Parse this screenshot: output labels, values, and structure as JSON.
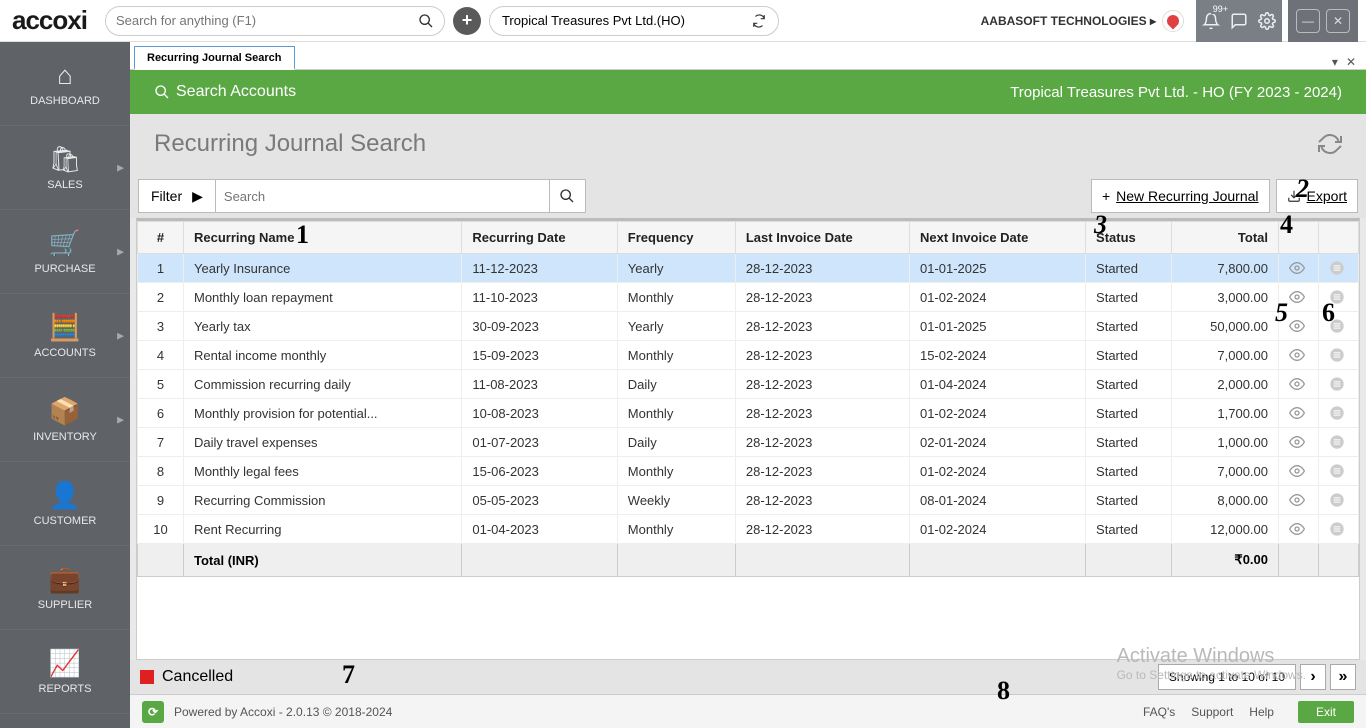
{
  "logo": "accoxi",
  "global_search_placeholder": "Search for anything (F1)",
  "company": "Tropical Treasures Pvt Ltd.(HO)",
  "org": "AABASOFT TECHNOLOGIES",
  "notif_badge": "99+",
  "sidebar": [
    {
      "label": "DASHBOARD",
      "icon": "⌂",
      "chev": false
    },
    {
      "label": "SALES",
      "icon": "🛍",
      "chev": true
    },
    {
      "label": "PURCHASE",
      "icon": "🛒",
      "chev": true
    },
    {
      "label": "ACCOUNTS",
      "icon": "🧮",
      "chev": true
    },
    {
      "label": "INVENTORY",
      "icon": "📦",
      "chev": true
    },
    {
      "label": "CUSTOMER",
      "icon": "👤",
      "chev": false
    },
    {
      "label": "SUPPLIER",
      "icon": "💼",
      "chev": false
    },
    {
      "label": "REPORTS",
      "icon": "📈",
      "chev": false
    }
  ],
  "tab_label": "Recurring Journal Search",
  "greenbar": {
    "left": "Search Accounts",
    "right": "Tropical Treasures Pvt Ltd. - HO (FY 2023 - 2024)"
  },
  "page_title": "Recurring Journal Search",
  "filter_label": "Filter",
  "local_search_placeholder": "Search",
  "new_btn": "New Recurring Journal",
  "export_btn": "Export",
  "columns": [
    "#",
    "Recurring Name",
    "Recurring Date",
    "Frequency",
    "Last Invoice Date",
    "Next Invoice Date",
    "Status",
    "Total"
  ],
  "rows": [
    {
      "n": "1",
      "name": "Yearly Insurance",
      "rdate": "11-12-2023",
      "freq": "Yearly",
      "last": "28-12-2023",
      "next": "01-01-2025",
      "status": "Started",
      "total": "7,800.00"
    },
    {
      "n": "2",
      "name": "Monthly loan repayment",
      "rdate": "11-10-2023",
      "freq": "Monthly",
      "last": "28-12-2023",
      "next": "01-02-2024",
      "status": "Started",
      "total": "3,000.00"
    },
    {
      "n": "3",
      "name": "Yearly tax",
      "rdate": "30-09-2023",
      "freq": "Yearly",
      "last": "28-12-2023",
      "next": "01-01-2025",
      "status": "Started",
      "total": "50,000.00"
    },
    {
      "n": "4",
      "name": "Rental income monthly",
      "rdate": "15-09-2023",
      "freq": "Monthly",
      "last": "28-12-2023",
      "next": "15-02-2024",
      "status": "Started",
      "total": "7,000.00"
    },
    {
      "n": "5",
      "name": "Commission recurring daily",
      "rdate": "11-08-2023",
      "freq": "Daily",
      "last": "28-12-2023",
      "next": "01-04-2024",
      "status": "Started",
      "total": "2,000.00"
    },
    {
      "n": "6",
      "name": "Monthly provision for potential...",
      "rdate": "10-08-2023",
      "freq": "Monthly",
      "last": "28-12-2023",
      "next": "01-02-2024",
      "status": "Started",
      "total": "1,700.00"
    },
    {
      "n": "7",
      "name": "Daily travel expenses",
      "rdate": "01-07-2023",
      "freq": "Daily",
      "last": "28-12-2023",
      "next": "02-01-2024",
      "status": "Started",
      "total": "1,000.00"
    },
    {
      "n": "8",
      "name": "Monthly legal fees",
      "rdate": "15-06-2023",
      "freq": "Monthly",
      "last": "28-12-2023",
      "next": "01-02-2024",
      "status": "Started",
      "total": "7,000.00"
    },
    {
      "n": "9",
      "name": "Recurring Commission",
      "rdate": "05-05-2023",
      "freq": "Weekly",
      "last": "28-12-2023",
      "next": "08-01-2024",
      "status": "Started",
      "total": "8,000.00"
    },
    {
      "n": "10",
      "name": "Rent Recurring",
      "rdate": "01-04-2023",
      "freq": "Monthly",
      "last": "28-12-2023",
      "next": "01-02-2024",
      "status": "Started",
      "total": "12,000.00"
    }
  ],
  "total_label": "Total (INR)",
  "total_value": "₹0.00",
  "legend": "Cancelled",
  "pager_text": "Showing 1 to 10 of 10",
  "footer_text": "Powered by Accoxi - 2.0.13 © 2018-2024",
  "footer_links": [
    "FAQ's",
    "Support",
    "Help"
  ],
  "exit": "Exit",
  "watermark": {
    "l1": "Activate Windows",
    "l2": "Go to Settings to activate Windows."
  },
  "annotations": [
    "1",
    "2",
    "3",
    "4",
    "5",
    "6",
    "7",
    "8"
  ]
}
